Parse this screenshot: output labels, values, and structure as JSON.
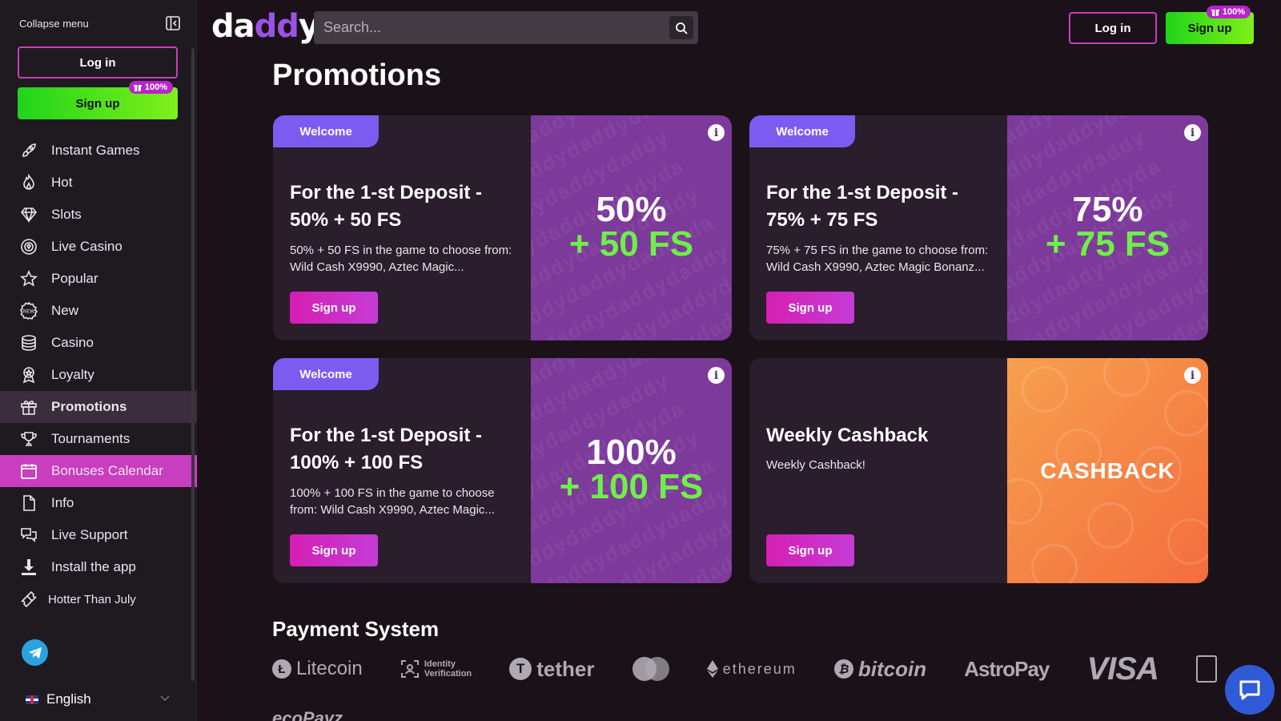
{
  "sidebar": {
    "collapse_label": "Collapse menu",
    "login_label": "Log in",
    "signup_label": "Sign up",
    "signup_badge": "100%",
    "nav": [
      {
        "label": "Instant Games",
        "icon": "rocket-icon"
      },
      {
        "label": "Hot",
        "icon": "flame-icon"
      },
      {
        "label": "Slots",
        "icon": "diamond-icon"
      },
      {
        "label": "Live Casino",
        "icon": "live-chip-icon"
      },
      {
        "label": "Popular",
        "icon": "star-icon"
      },
      {
        "label": "New",
        "icon": "new-badge-icon"
      },
      {
        "label": "Casino",
        "icon": "coins-icon"
      },
      {
        "label": "Loyalty",
        "icon": "medal-icon"
      },
      {
        "label": "Promotions",
        "icon": "gift-icon"
      },
      {
        "label": "Tournaments",
        "icon": "trophy-icon"
      },
      {
        "label": "Bonuses Calendar",
        "icon": "calendar-icon"
      },
      {
        "label": "Info",
        "icon": "document-icon"
      },
      {
        "label": "Live Support",
        "icon": "chat-bubbles-icon"
      },
      {
        "label": "Install the app",
        "icon": "download-icon"
      },
      {
        "label": "Hotter Than July",
        "icon": "ticket-icon"
      }
    ],
    "language": "English"
  },
  "header": {
    "logo_part1": "da",
    "logo_part2": "dd",
    "logo_part3": "y",
    "search_placeholder": "Search...",
    "login_label": "Log in",
    "signup_label": "Sign up",
    "signup_badge": "100%"
  },
  "main": {
    "title": "Promotions",
    "cards": [
      {
        "tag": "Welcome",
        "title": "For the 1-st Deposit - 50% + 50 FS",
        "description": "50% + 50 FS in the game to choose from: Wild Cash X9990, Aztec Magic...",
        "button": "Sign up",
        "art_line1": "50%",
        "art_line2": "+ 50 FS"
      },
      {
        "tag": "Welcome",
        "title": "For the 1-st Deposit - 75% + 75 FS",
        "description": "75% + 75 FS in the game to choose from: Wild Cash X9990, Aztec Magic Bonanz...",
        "button": "Sign up",
        "art_line1": "75%",
        "art_line2": "+ 75 FS"
      },
      {
        "tag": "Welcome",
        "title": "For the 1-st Deposit - 100% + 100 FS",
        "description": "100% + 100 FS in the game to choose from: Wild Cash X9990, Aztec Magic...",
        "button": "Sign up",
        "art_line1": "100%",
        "art_line2": "+ 100 FS"
      },
      {
        "title": "Weekly Cashback",
        "description": "Weekly Cashback!",
        "button": "Sign up",
        "art_line1": "CASHBACK"
      }
    ],
    "payment_title": "Payment System",
    "payments": {
      "litecoin": "Litecoin",
      "identity_line1": "Identity",
      "identity_line2": "Verification",
      "tether": "tether",
      "ethereum": "ethereum",
      "bitcoin": "bitcoin",
      "astropay": "AstroPay",
      "visa": "VISA",
      "ecopayz": "ecoPayz"
    }
  },
  "colors": {
    "accent_magenta": "#c93dbf",
    "signup_green": "#20d41a",
    "promo_purple": "#7d3a9b",
    "tag_violet": "#7c5cf0",
    "fs_green": "#6ef048"
  }
}
